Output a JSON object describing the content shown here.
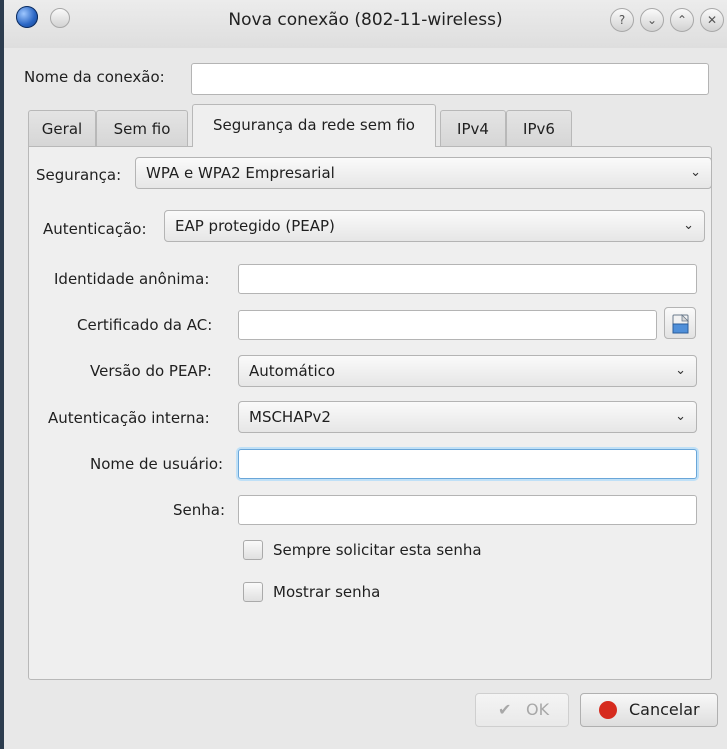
{
  "window": {
    "title": "Nova conexão (802-11-wireless)",
    "titlebar_buttons": [
      "help-icon",
      "minimize-icon",
      "maximize-icon",
      "close-icon"
    ]
  },
  "connection_name": {
    "label": "Nome da conexão:",
    "value": ""
  },
  "tabs": [
    {
      "label": "Geral"
    },
    {
      "label": "Sem fio"
    },
    {
      "label": "Segurança da rede sem fio",
      "active": true
    },
    {
      "label": "IPv4"
    },
    {
      "label": "IPv6"
    }
  ],
  "security": {
    "label": "Segurança:",
    "value": "WPA e WPA2 Empresarial",
    "authentication": {
      "label": "Autenticação:",
      "value": "EAP protegido (PEAP)"
    },
    "anonymous_identity": {
      "label": "Identidade anônima:",
      "value": ""
    },
    "ca_certificate": {
      "label": "Certificado da AC:",
      "value": ""
    },
    "peap_version": {
      "label": "Versão do PEAP:",
      "value": "Automático"
    },
    "inner_authentication": {
      "label": "Autenticação interna:",
      "value": "MSCHAPv2"
    },
    "username": {
      "label": "Nome de usuário:",
      "value": ""
    },
    "password": {
      "label": "Senha:",
      "value": ""
    },
    "always_ask_password": {
      "label": "Sempre solicitar esta senha",
      "checked": false
    },
    "show_password": {
      "label": "Mostrar senha",
      "checked": false
    }
  },
  "buttons": {
    "ok": "OK",
    "cancel": "Cancelar"
  },
  "colors": {
    "focus_border": "#6aa6d8",
    "cancel_icon": "#d62b1e"
  }
}
